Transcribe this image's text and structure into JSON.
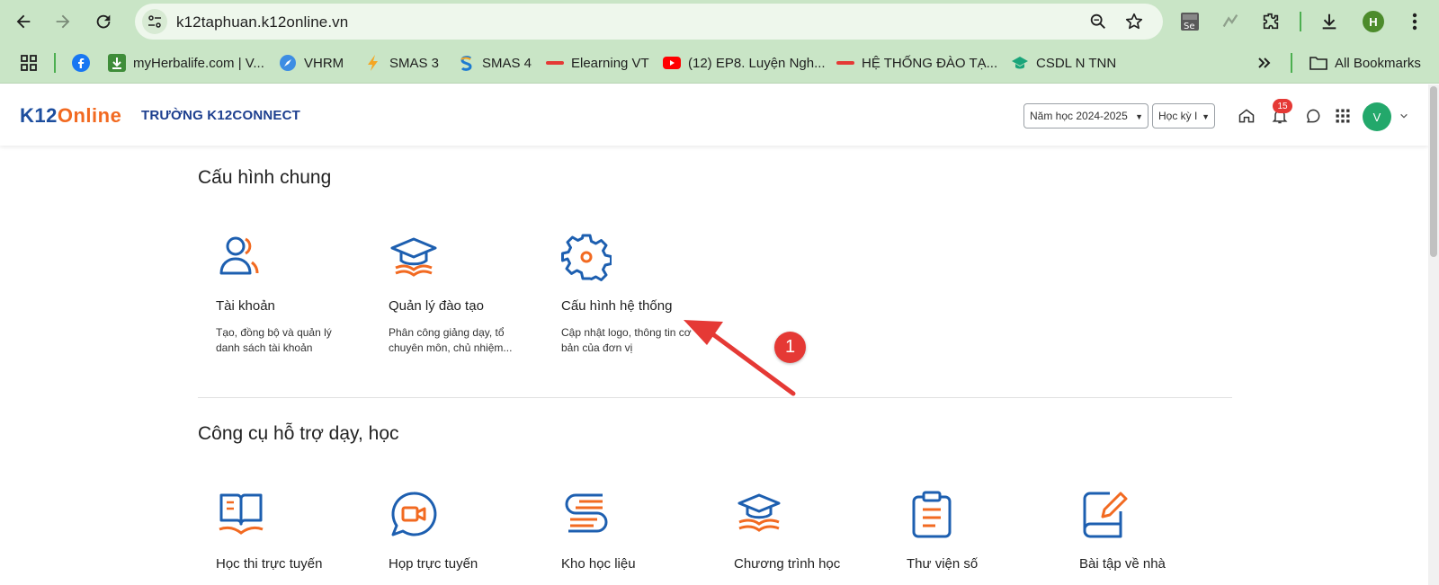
{
  "browser": {
    "url": "k12taphuan.k12online.vn",
    "profile_initial": "H",
    "bookmarks": [
      {
        "label": "myHerbalife.com | V...",
        "icon": "herbalife-icon"
      },
      {
        "label": "VHRM",
        "icon": "compass-icon"
      },
      {
        "label": "SMAS 3",
        "icon": "bolt-icon"
      },
      {
        "label": "SMAS 4",
        "icon": "smas-icon"
      },
      {
        "label": "Elearning VT",
        "icon": "viettel-icon"
      },
      {
        "label": "(12) EP8. Luyện Ngh...",
        "icon": "youtube-icon"
      },
      {
        "label": "HỆ THỐNG ĐÀO TẠ...",
        "icon": "viettel-icon"
      },
      {
        "label": "CSDL N TNN",
        "icon": "graduation-icon"
      }
    ],
    "all_bookmarks": "All Bookmarks",
    "ext_se_label": "Se"
  },
  "header": {
    "logo_k12": "K12",
    "logo_online": "Online",
    "school": "TRƯỜNG K12CONNECT",
    "year_select": "Năm học 2024-2025",
    "term_select": "Học kỳ I",
    "notification_count": "15",
    "avatar_initial": "V"
  },
  "sections": [
    {
      "title": "Cấu hình chung",
      "cards": [
        {
          "title": "Tài khoản",
          "desc": "Tạo, đồng bộ và quản lý danh sách tài khoản",
          "icon": "users-icon"
        },
        {
          "title": "Quản lý đào tạo",
          "desc": "Phân công giảng dạy, tổ chuyên môn, chủ nhiệm...",
          "icon": "graduation-cap-icon"
        },
        {
          "title": "Cấu hình hệ thống",
          "desc": "Cập nhật logo, thông tin cơ bản của đơn vị",
          "icon": "gear-icon"
        }
      ]
    },
    {
      "title": "Công cụ hỗ trợ dạy, học",
      "cards": [
        {
          "title": "Học thi trực tuyến",
          "icon": "book-icon"
        },
        {
          "title": "Họp trực tuyến",
          "icon": "video-chat-icon"
        },
        {
          "title": "Kho học liệu",
          "icon": "library-icon"
        },
        {
          "title": "Chương trình học",
          "icon": "curriculum-icon"
        },
        {
          "title": "Thư viện số",
          "icon": "clipboard-icon"
        },
        {
          "title": "Bài tập về nhà",
          "icon": "homework-icon"
        }
      ]
    }
  ],
  "annotation": {
    "marker": "1",
    "color": "#e53935"
  },
  "colors": {
    "chrome": "#c9e5c6",
    "brand_blue": "#1d4e9e",
    "brand_orange": "#f26a21",
    "accent_green": "#23a86b"
  }
}
